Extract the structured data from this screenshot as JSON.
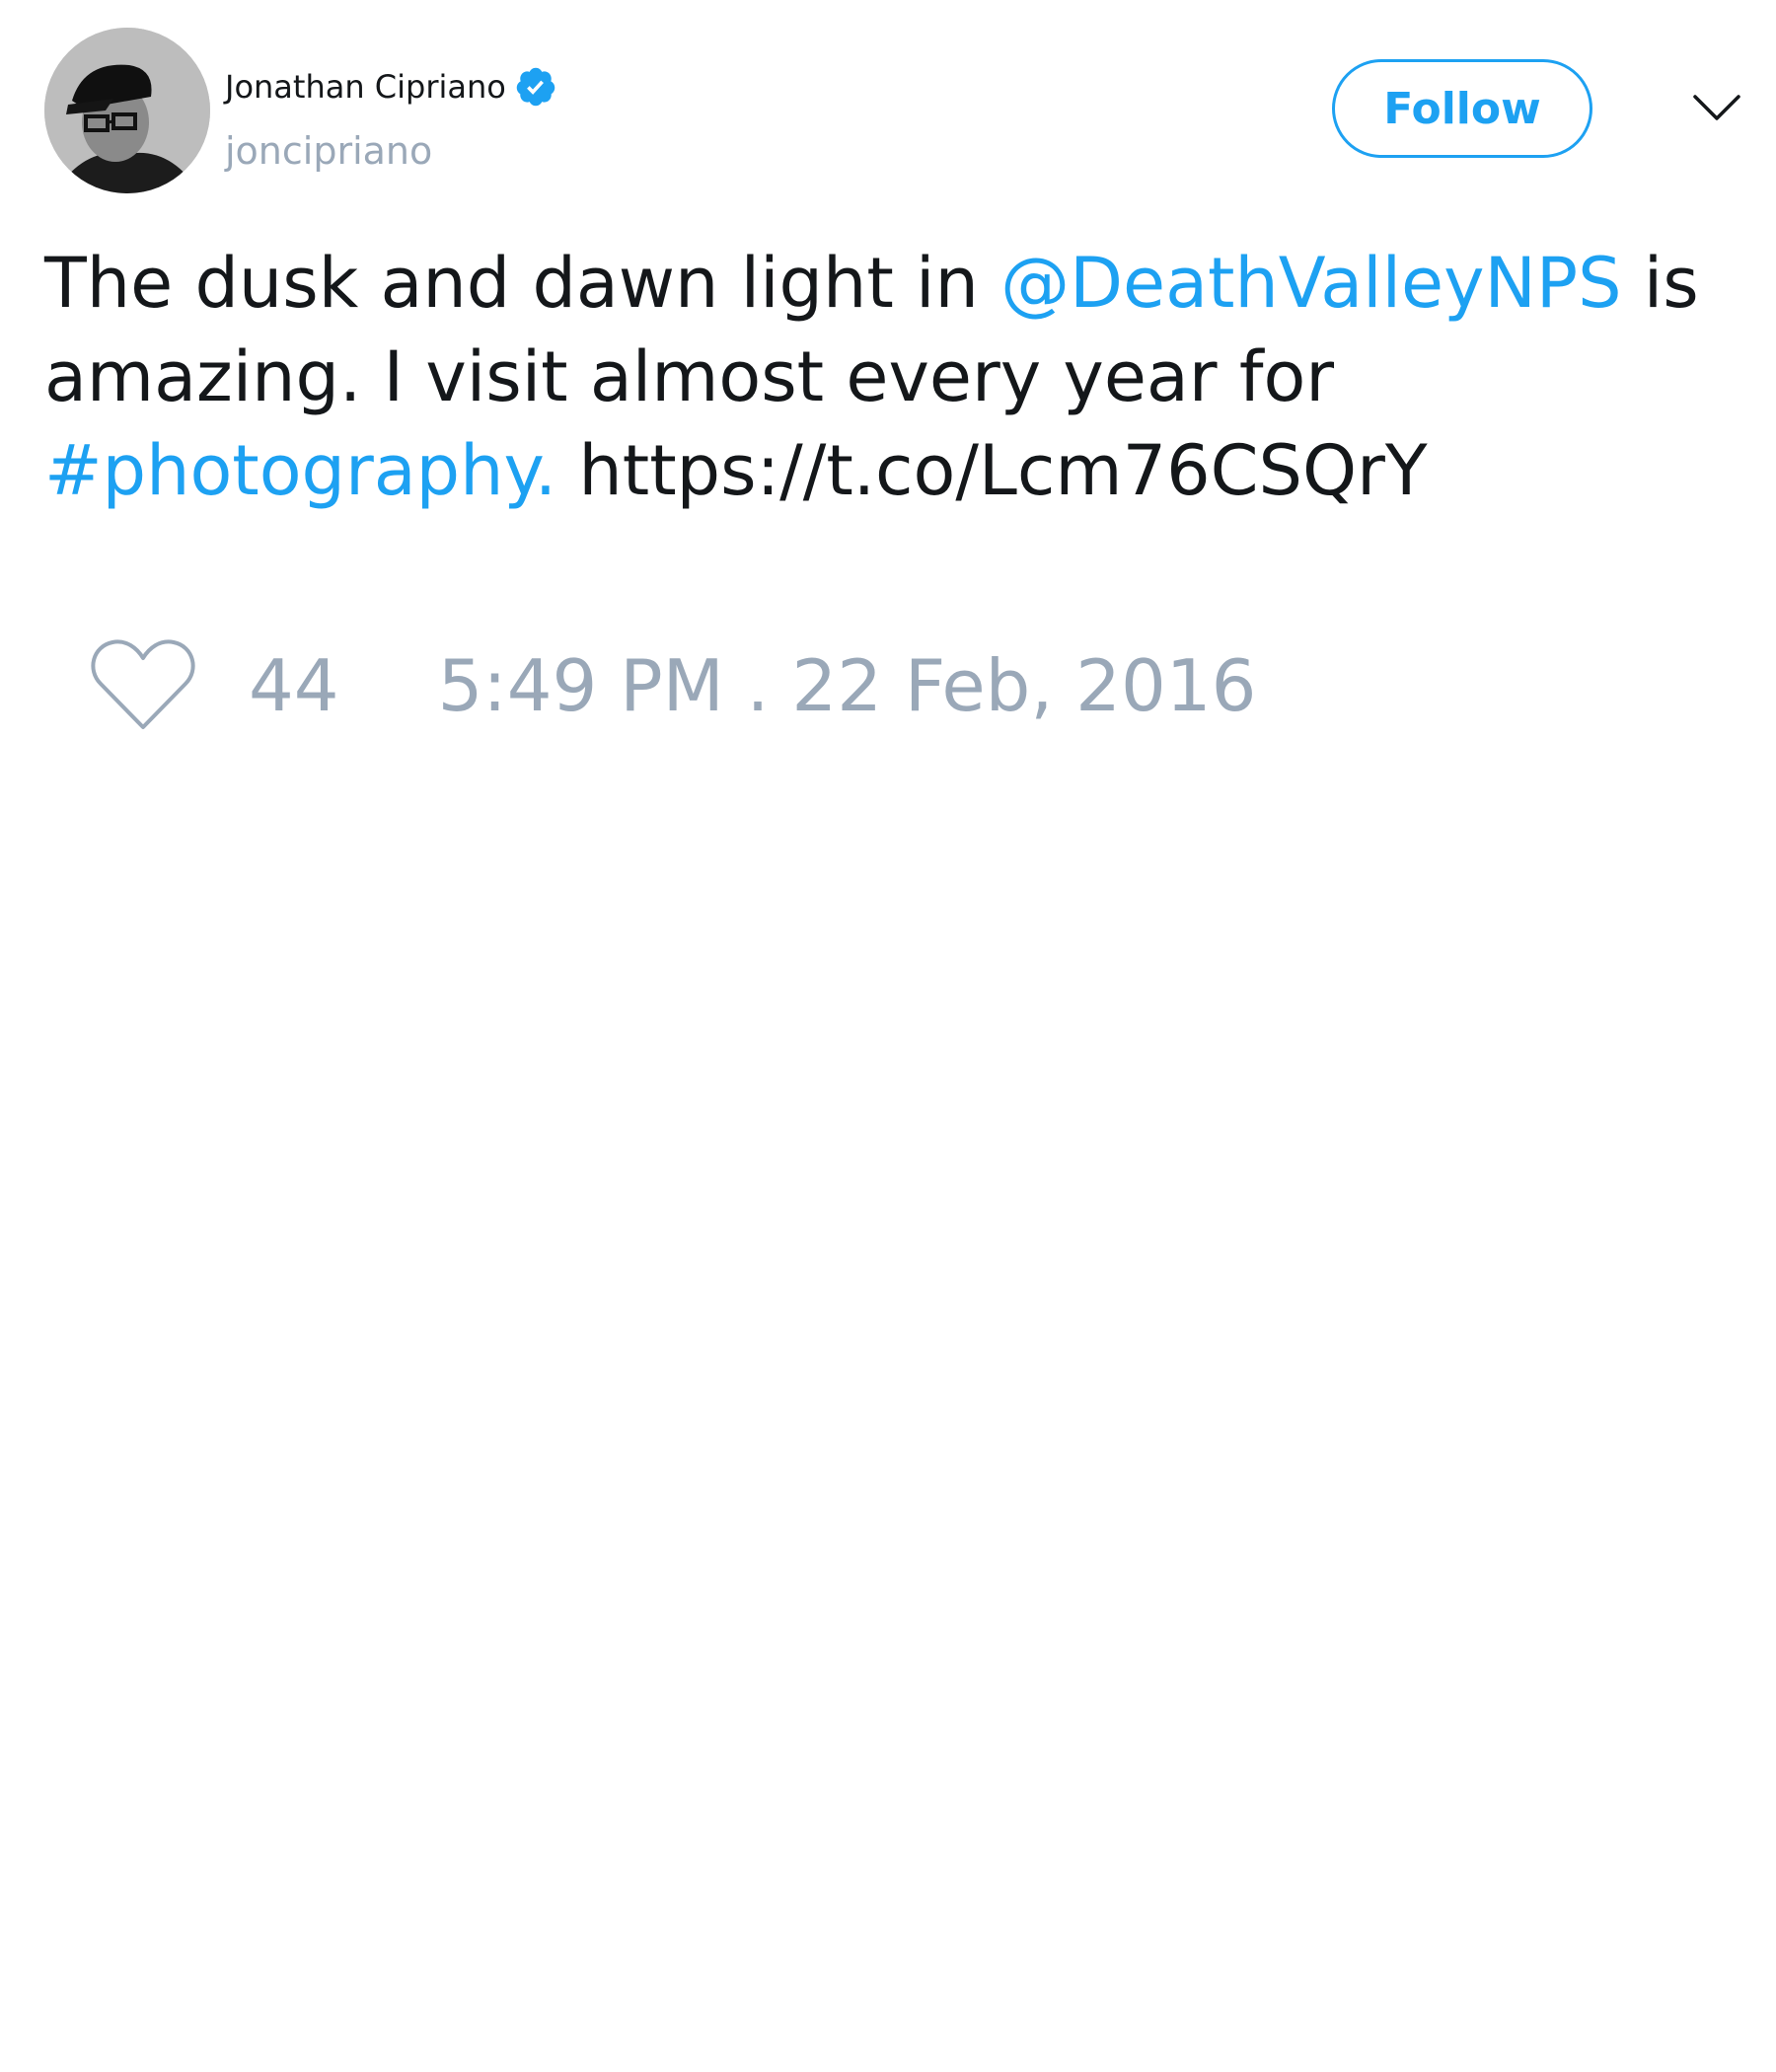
{
  "user": {
    "display_name": "Jonathan Cipriano",
    "handle": "joncipriano",
    "verified": true
  },
  "actions": {
    "follow_label": "Follow"
  },
  "tweet": {
    "text_parts": {
      "part1": "The dusk and dawn light in ",
      "mention": "@DeathValleyNPS",
      "part2": " is amazing. I visit almost every year for ",
      "hashtag": "#photography.",
      "part3": " ",
      "url": "https://t.co/Lcm76CSQrY"
    },
    "likes": "44",
    "timestamp": "5:49 PM . 22 Feb, 2016"
  },
  "icons": {
    "verified": "verified-badge-icon",
    "caret": "chevron-down-icon",
    "like": "heart-icon"
  },
  "colors": {
    "accent": "#1da1f2",
    "muted": "#9aa8b8",
    "text": "#14171a"
  }
}
